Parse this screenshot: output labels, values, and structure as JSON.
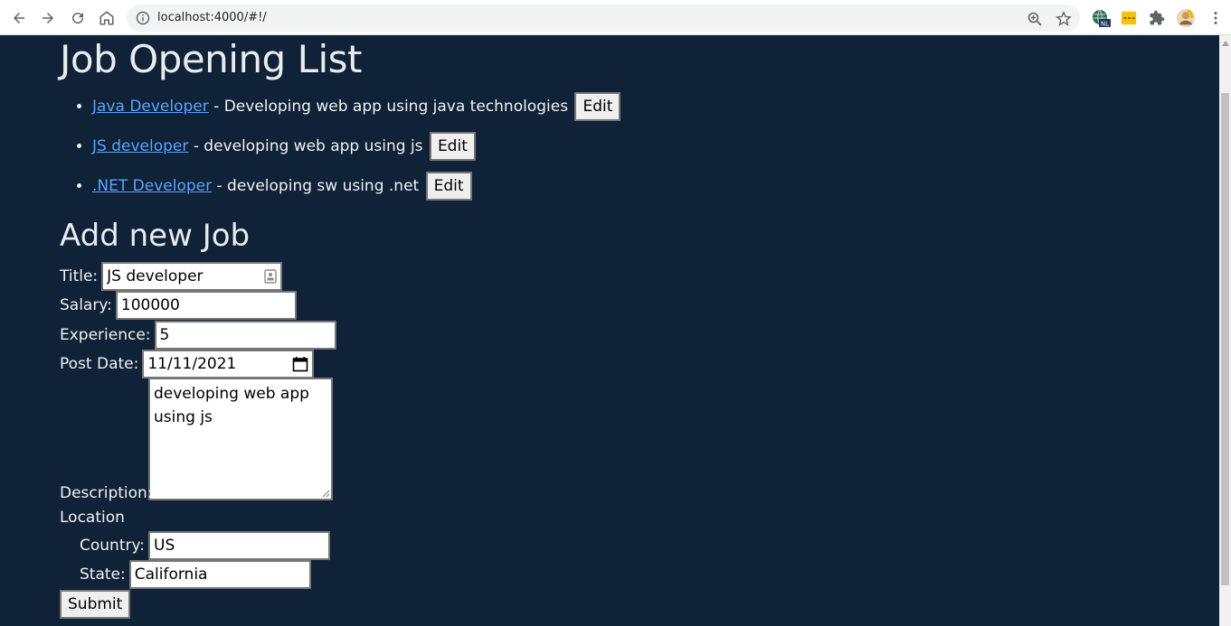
{
  "browser": {
    "url": "localhost:4000/#!/",
    "extension_badge": "NL"
  },
  "page": {
    "list_title": "Job Opening List",
    "jobs": [
      {
        "title": "Java Developer",
        "description": " - Developing web app using java technologies ",
        "edit_label": "Edit"
      },
      {
        "title": "JS developer",
        "description": " - developing web app using js ",
        "edit_label": "Edit"
      },
      {
        "title": ".NET Developer",
        "description": " - developing sw using .net ",
        "edit_label": "Edit"
      }
    ],
    "form": {
      "heading": "Add new Job",
      "title_label": "Title:",
      "title_value": "JS developer",
      "salary_label": "Salary:",
      "salary_value": "100000",
      "experience_label": "Experience:",
      "experience_value": "5",
      "post_date_label": "Post Date:",
      "post_date_value": "11/11/2021",
      "description_label": "Description:",
      "description_value": "developing web app using js",
      "location_label": "Location",
      "country_label": "Country:",
      "country_value": "US",
      "state_label": "State:",
      "state_value": "California",
      "submit_label": "Submit"
    }
  },
  "colors": {
    "page_background": "#0f2237",
    "link": "#5aa4ff"
  },
  "icons": [
    "back-icon",
    "forward-icon",
    "reload-icon",
    "home-icon",
    "info-icon",
    "zoom-icon",
    "star-icon",
    "globe-extension-icon",
    "yellow-extension-icon",
    "puzzle-icon",
    "profile-avatar",
    "more-icon",
    "contact-card-icon",
    "calendar-icon"
  ]
}
